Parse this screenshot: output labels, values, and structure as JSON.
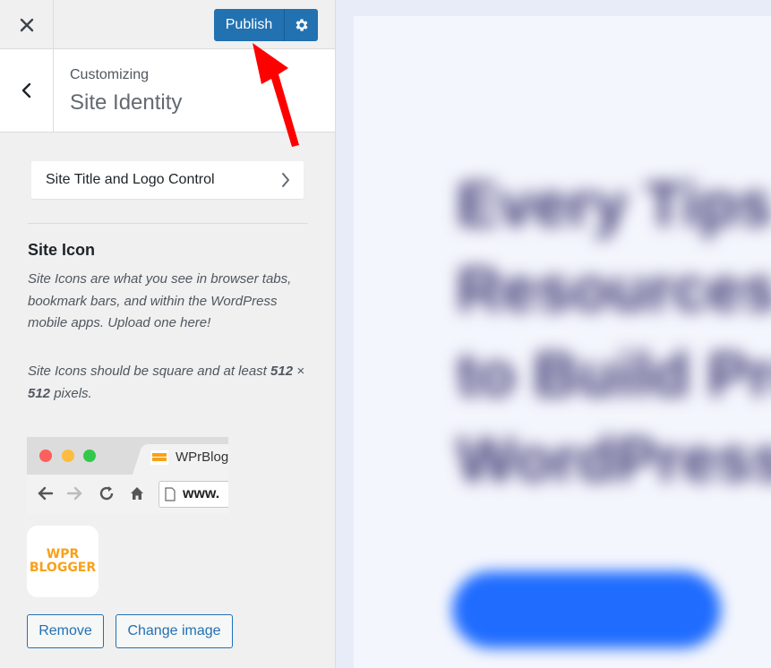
{
  "topbar": {
    "close_icon": "close-icon",
    "publish_label": "Publish",
    "settings_icon": "gear-icon"
  },
  "header": {
    "back_icon": "chevron-left-icon",
    "breadcrumb": "Customizing",
    "title": "Site Identity"
  },
  "controls": {
    "site_title_logo": "Site Title and Logo Control"
  },
  "site_icon": {
    "title": "Site Icon",
    "description": "Site Icons are what you see in browser tabs, bookmark bars, and within the WordPress mobile apps. Upload one here!",
    "size_note_prefix": "Site Icons should be square and at least ",
    "size_w": "512",
    "size_x": " × ",
    "size_h": "512",
    "size_note_suffix": " pixels.",
    "browser_tab_title": "WPrBlogger",
    "browser_url": "www.",
    "logo_line1": "WPR",
    "logo_line2": "BLOGGER",
    "remove_label": "Remove",
    "change_label": "Change image"
  },
  "preview": {
    "blurred_lines": [
      "Every Tips a",
      "Resources",
      "to Build Pro",
      "WordPress"
    ]
  },
  "colors": {
    "primary": "#2271b1",
    "annotation": "#ff0000",
    "logo_orange": "#f7a11a"
  }
}
